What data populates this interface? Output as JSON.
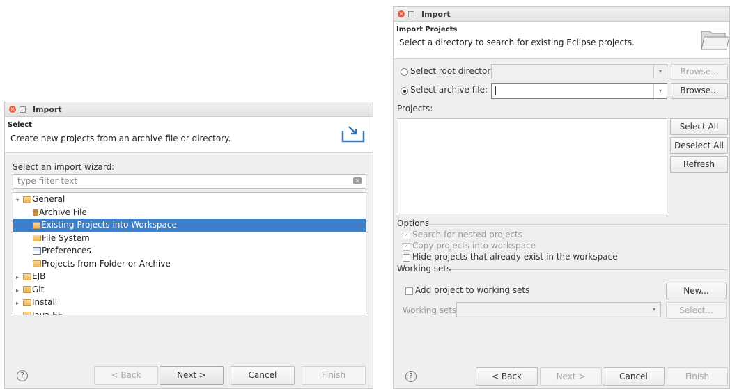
{
  "left": {
    "title": "Import",
    "header_title": "Select",
    "header_desc": "Create new projects from an archive file or directory.",
    "wizard_label": "Select an import wizard:",
    "filter_placeholder": "type filter text",
    "tree": [
      {
        "label": "General",
        "level": 0,
        "arrow": "▾",
        "icon": "folder"
      },
      {
        "label": "Archive File",
        "level": 1,
        "arrow": "",
        "icon": "arch"
      },
      {
        "label": "Existing Projects into Workspace",
        "level": 1,
        "arrow": "",
        "icon": "proj",
        "selected": true
      },
      {
        "label": "File System",
        "level": 1,
        "arrow": "",
        "icon": "folder"
      },
      {
        "label": "Preferences",
        "level": 1,
        "arrow": "",
        "icon": "pref"
      },
      {
        "label": "Projects from Folder or Archive",
        "level": 1,
        "arrow": "",
        "icon": "folder"
      },
      {
        "label": "EJB",
        "level": 0,
        "arrow": "▸",
        "icon": "folder"
      },
      {
        "label": "Git",
        "level": 0,
        "arrow": "▸",
        "icon": "folder"
      },
      {
        "label": "Install",
        "level": 0,
        "arrow": "▸",
        "icon": "folder"
      },
      {
        "label": "Java EE",
        "level": 0,
        "arrow": "▸",
        "icon": "folder"
      }
    ],
    "buttons": {
      "back": "< Back",
      "next": "Next >",
      "cancel": "Cancel",
      "finish": "Finish"
    },
    "help": "?"
  },
  "right": {
    "title": "Import",
    "header_title": "Import Projects",
    "header_desc": "Select a directory to search for existing Eclipse projects.",
    "root_dir_label": "Select root directory:",
    "archive_label": "Select archive file:",
    "browse_label": "Browse...",
    "projects_label": "Projects:",
    "select_all": "Select All",
    "deselect_all": "Deselect All",
    "refresh": "Refresh",
    "options_label": "Options",
    "opt_nested": "Search for nested projects",
    "opt_copy": "Copy projects into workspace",
    "opt_hide": "Hide projects that already exist in the workspace",
    "working_sets_group": "Working sets",
    "add_to_ws": "Add project to working sets",
    "new_btn": "New...",
    "ws_label": "Working sets:",
    "select_btn": "Select...",
    "buttons": {
      "back": "< Back",
      "next": "Next >",
      "cancel": "Cancel",
      "finish": "Finish"
    },
    "help": "?"
  }
}
